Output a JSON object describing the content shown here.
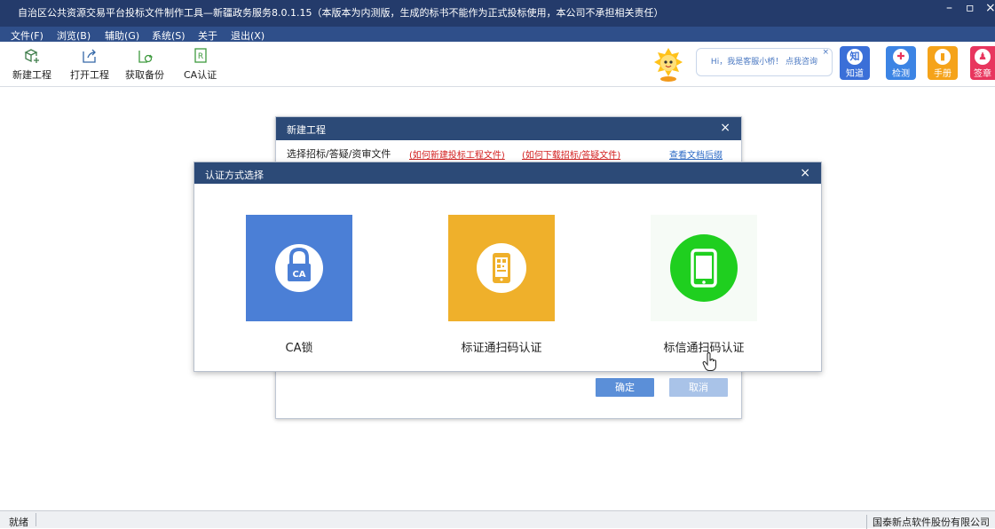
{
  "window": {
    "title": "自治区公共资源交易平台投标文件制作工具—新疆政务服务8.0.1.15（本版本为内测版，生成的标书不能作为正式投标使用，本公司不承担相关责任）",
    "minimize": "–",
    "restore": "▫",
    "close": "×"
  },
  "menu": [
    "文件(F)",
    "浏览(B)",
    "辅助(G)",
    "系统(S)",
    "关于",
    "退出(X)"
  ],
  "toolbar": {
    "items": [
      {
        "label": "新建工程",
        "icon": "new-project-icon"
      },
      {
        "label": "打开工程",
        "icon": "open-project-icon"
      },
      {
        "label": "获取备份",
        "icon": "backup-icon"
      },
      {
        "label": "CA认证",
        "icon": "ca-cert-icon"
      }
    ],
    "assistant_text": "Hi，我是客服小桥！ 点我咨询",
    "assistant_close": "×",
    "right_buttons": [
      {
        "label": "知道",
        "glyph": "知",
        "color": "#3a6fd8"
      },
      {
        "label": "检测",
        "glyph": "✚",
        "color": "#3c84e4"
      },
      {
        "label": "手册",
        "glyph": "▮",
        "color": "#f5a31a"
      },
      {
        "label": "签章",
        "glyph": "♟",
        "color": "#e8365e"
      }
    ]
  },
  "new_project_dialog": {
    "title": "新建工程",
    "close": "×",
    "choose_label": "选择招标/答疑/资审文件",
    "link1": "(如何新建投标工程文件)",
    "link2": "(如何下载招标/答疑文件)",
    "link3": "查看文档后缀",
    "confirm": "确定",
    "cancel": "取消"
  },
  "auth_dialog": {
    "title": "认证方式选择",
    "close": "×",
    "options": [
      {
        "label": "CA锁",
        "icon": "ca-lock-icon",
        "badge": "CA",
        "color": "#4b7fd6"
      },
      {
        "label": "标证通扫码认证",
        "icon": "biaozhengtong-qr-icon",
        "color": "#efb02b"
      },
      {
        "label": "标信通扫码认证",
        "icon": "biaoxintong-phone-icon",
        "color": "#1fcf1f"
      }
    ]
  },
  "status": {
    "left": "就绪",
    "right": "国泰新点软件股份有限公司"
  },
  "colors": {
    "titlebar": "#243b6b",
    "menubar": "#2f4f8a",
    "dialog_header": "#2c4a77",
    "confirm_button": "#5b8fd8",
    "cancel_button": "#a9c3e8"
  }
}
